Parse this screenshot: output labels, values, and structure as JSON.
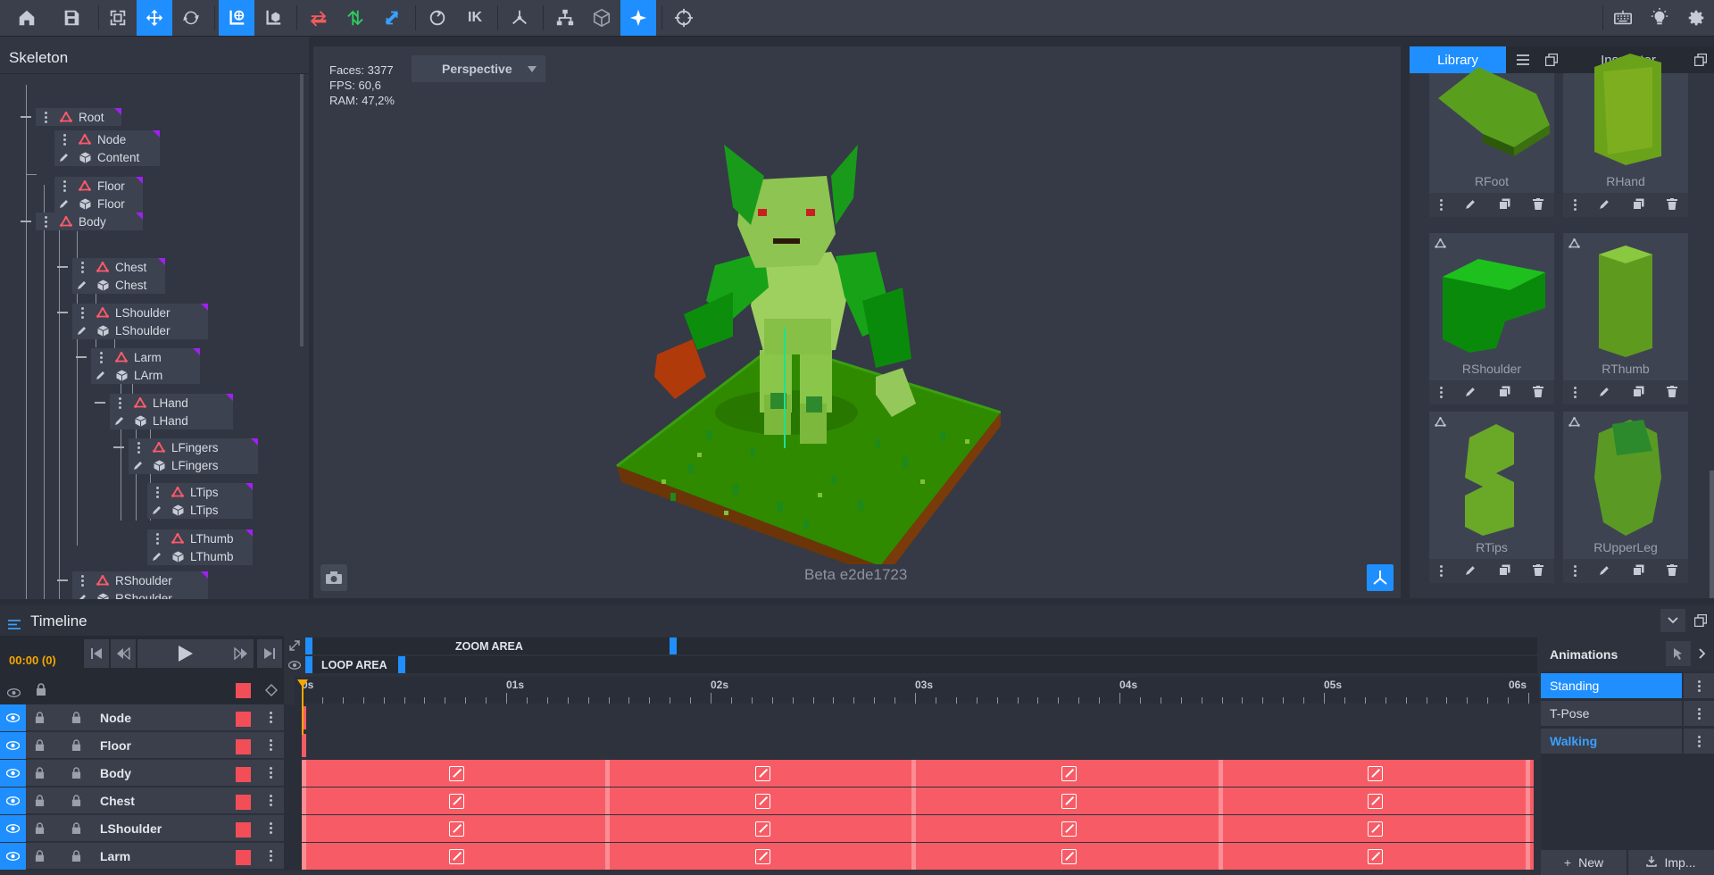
{
  "toolbar": {
    "icons": [
      "home-icon",
      "save-icon",
      "fit-icon",
      "move-icon",
      "rotate-icon",
      "local-global-icon",
      "pivot-icon",
      "swap-icon",
      "swap-vertical-icon",
      "flip-icon",
      "ik-rotate-icon",
      "ik-label",
      "joint-icon",
      "hierarchy-icon",
      "cube-icon",
      "sparkle-icon",
      "target-icon",
      "keyboard-icon",
      "light-icon",
      "settings-icon"
    ],
    "ik_label": "IK"
  },
  "skeleton": {
    "title": "Skeleton",
    "nodes": [
      {
        "bone": "Root",
        "mesh": ""
      },
      {
        "bone": "Node",
        "mesh": "Content"
      },
      {
        "bone": "Floor",
        "mesh": "Floor"
      },
      {
        "bone": "Body",
        "mesh": ""
      },
      {
        "bone": "Chest",
        "mesh": "Chest"
      },
      {
        "bone": "LShoulder",
        "mesh": "LShoulder"
      },
      {
        "bone": "Larm",
        "mesh": "LArm"
      },
      {
        "bone": "LHand",
        "mesh": "LHand"
      },
      {
        "bone": "LFingers",
        "mesh": "LFingers"
      },
      {
        "bone": "LTips",
        "mesh": "LTips"
      },
      {
        "bone": "LThumb",
        "mesh": "LThumb"
      },
      {
        "bone": "RShoulder",
        "mesh": "RShoulder"
      }
    ]
  },
  "viewport": {
    "faces": "Faces: 3377",
    "fps": "FPS: 60,6",
    "ram": "RAM: 47,2%",
    "view_mode": "Perspective",
    "build": "Beta e2de1723"
  },
  "library": {
    "tab_library": "Library",
    "tab_inspector": "Inspector",
    "items": [
      {
        "name": "RFoot",
        "color": "#5a9e1e"
      },
      {
        "name": "RHand",
        "color": "#6aa21a"
      },
      {
        "name": "RShoulder",
        "color": "#0a8a0a"
      },
      {
        "name": "RThumb",
        "color": "#5e9a1e"
      },
      {
        "name": "RTips",
        "color": "#6aa828"
      },
      {
        "name": "RUpperLeg",
        "color": "#5a9a24"
      }
    ]
  },
  "timeline": {
    "title": "Timeline",
    "current_time": "00:00 (0)",
    "zoom_label": "ZOOM AREA",
    "loop_label": "LOOP AREA",
    "ruler": [
      "0s",
      "01s",
      "02s",
      "03s",
      "04s",
      "05s",
      "06s"
    ],
    "rows": [
      {
        "name": "Node",
        "keyed": false
      },
      {
        "name": "Floor",
        "keyed": false
      },
      {
        "name": "Body",
        "keyed": true
      },
      {
        "name": "Chest",
        "keyed": true
      },
      {
        "name": "LShoulder",
        "keyed": true
      },
      {
        "name": "Larm",
        "keyed": true
      }
    ],
    "accent": "#1f8fff",
    "track_color": "#f75c66"
  },
  "animations": {
    "title": "Animations",
    "items": [
      {
        "name": "Standing",
        "state": "selected"
      },
      {
        "name": "T-Pose",
        "state": "normal"
      },
      {
        "name": "Walking",
        "state": "active"
      }
    ],
    "new_label": "New",
    "import_label": "Imp..."
  }
}
